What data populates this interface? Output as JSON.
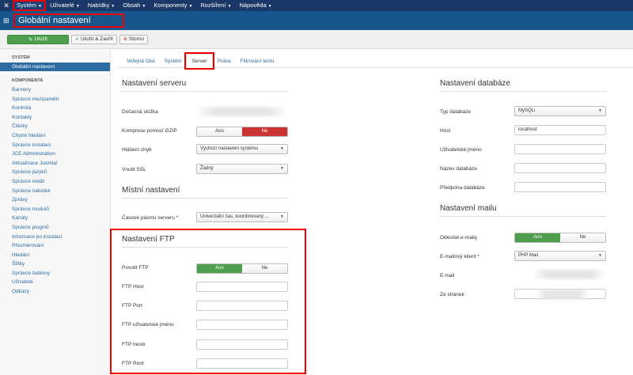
{
  "topnav": {
    "items": [
      {
        "label": "Systém",
        "active": true
      },
      {
        "label": "Uživatelé"
      },
      {
        "label": "Nabídky"
      },
      {
        "label": "Obsah"
      },
      {
        "label": "Komponenty"
      },
      {
        "label": "Rozšíření"
      },
      {
        "label": "Nápověda"
      }
    ]
  },
  "header": {
    "title": "Globální nastavení"
  },
  "toolbar": {
    "save_label": "Uložit",
    "save_close_label": "Uložit & Zavřít",
    "cancel_label": "Storno"
  },
  "sidebar": {
    "system_heading": "SYSTÉM",
    "system_active": "Globální nastavení",
    "component_heading": "KOMPONENTA",
    "items": [
      "Bannery",
      "Správce mezipamětí",
      "Kontrola",
      "Kontakty",
      "Články",
      "Chytré hledání",
      "Správce instalací",
      "JCE Administration",
      "Aktualizace Joomla!",
      "Správce jazyků",
      "Správce médií",
      "Správce nabídek",
      "Zprávy",
      "Správce modulů",
      "Kanály",
      "Správce pluginů",
      "Informace po instalaci",
      "Přesměrování",
      "Hledání",
      "Štítky",
      "Správce šablony",
      "Uživatelé",
      "Odkazy"
    ]
  },
  "tabs": [
    "Veřejná část",
    "Systém",
    "Server",
    "Práva",
    "Filtrování textu"
  ],
  "server": {
    "title": "Nastavení serveru",
    "tmp_label": "Dočasná složka",
    "gzip_label": "Komprese pomocí GZIP",
    "gzip_yes": "Ano",
    "gzip_no": "Ne",
    "error_label": "Hlášení chyb",
    "error_value": "Výchozí nastavení systému",
    "ssl_label": "Vnutit SSL",
    "ssl_value": "Žádný"
  },
  "local": {
    "title": "Místní nastavení",
    "tz_label": "Časové pásmo serveru *",
    "tz_value": "Univerzální čas, koordinovaný ..."
  },
  "ftp": {
    "title": "Nastavení FTP",
    "enable_label": "Povolit FTP",
    "enable_yes": "Ano",
    "enable_no": "Ne",
    "host_label": "FTP Host",
    "port_label": "FTP Port",
    "user_label": "FTP uživatelské jméno",
    "pass_label": "FTP heslo",
    "root_label": "FTP Root"
  },
  "database": {
    "title": "Nastavení databáze",
    "type_label": "Typ databáze",
    "type_value": "MySQLi",
    "host_label": "Host",
    "host_value": "localhost",
    "user_label": "Uživatelské jméno",
    "name_label": "Název databáze",
    "prefix_label": "Předpona databáze"
  },
  "mail": {
    "title": "Nastavení mailu",
    "send_label": "Odesílat e-maily",
    "send_yes": "Ano",
    "send_no": "Ne",
    "client_label": "E-mailový klient *",
    "client_value": "PHP Mail",
    "email_label": "E-mail",
    "from_label": "Ze stránek"
  }
}
